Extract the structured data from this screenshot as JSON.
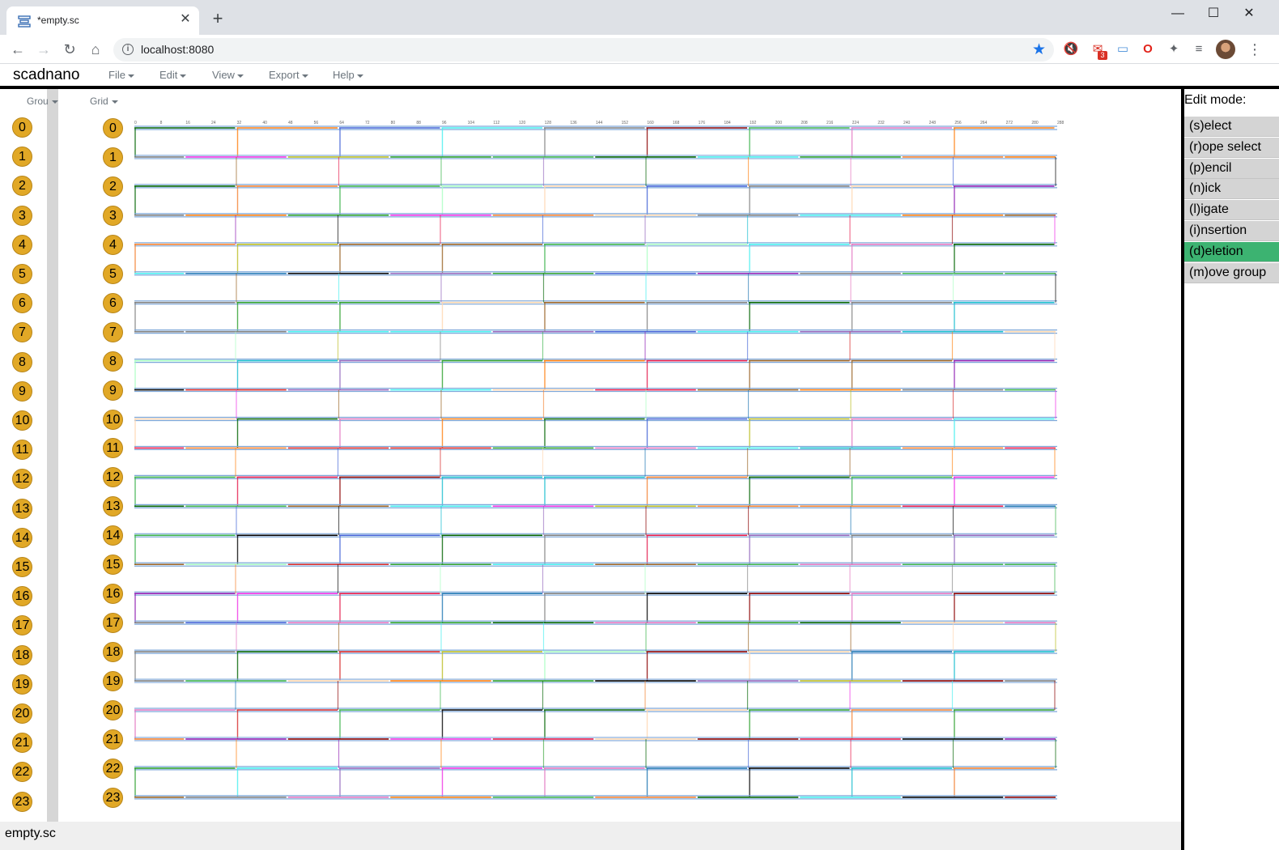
{
  "browser": {
    "tab_title": "*empty.sc",
    "tab_close": "✕",
    "new_tab": "+",
    "url": "localhost:8080",
    "mail_badge": "3",
    "window_controls": {
      "minimize": "—",
      "maximize": "☐",
      "close": "✕"
    }
  },
  "app": {
    "title": "scadnano",
    "menus": [
      "File",
      "Edit",
      "View",
      "Export",
      "Help"
    ]
  },
  "side": {
    "group_label": "Grou",
    "grid_label": "Grid",
    "helices": [
      "0",
      "1",
      "2",
      "3",
      "4",
      "5",
      "6",
      "7",
      "8",
      "9",
      "10",
      "11",
      "12",
      "13",
      "14",
      "15",
      "16",
      "17",
      "18",
      "19",
      "20",
      "21",
      "22",
      "23"
    ]
  },
  "design": {
    "ruler_ticks": [
      "0",
      "8",
      "16",
      "24",
      "32",
      "40",
      "48",
      "56",
      "64",
      "72",
      "80",
      "88",
      "96",
      "104",
      "112",
      "120",
      "128",
      "136",
      "144",
      "152",
      "160",
      "168",
      "176",
      "184",
      "192",
      "200",
      "208",
      "216",
      "224",
      "232",
      "240",
      "248",
      "256",
      "264",
      "272",
      "280",
      "288"
    ],
    "strand_colors": [
      "#e6194b",
      "#3cb44b",
      "#4363d8",
      "#f58231",
      "#911eb4",
      "#46f0f0",
      "#f032e6",
      "#9a6324",
      "#000000",
      "#808080",
      "#006400",
      "#8b0000",
      "#ff7f0e",
      "#1f77b4",
      "#2ca02c",
      "#d62728",
      "#9467bd",
      "#bcbd22",
      "#17becf",
      "#e377c2",
      "#aaffc3",
      "#ffd8b1"
    ]
  },
  "edit_panel": {
    "label": "Edit mode:",
    "modes": [
      "(s)elect",
      "(r)ope select",
      "(p)encil",
      "(n)ick",
      "(l)igate",
      "(i)nsertion",
      "(d)eletion",
      "(m)ove group"
    ],
    "active_mode": "(d)eletion",
    "active_color": "#3cb371"
  },
  "footer": {
    "filename": "empty.sc"
  }
}
